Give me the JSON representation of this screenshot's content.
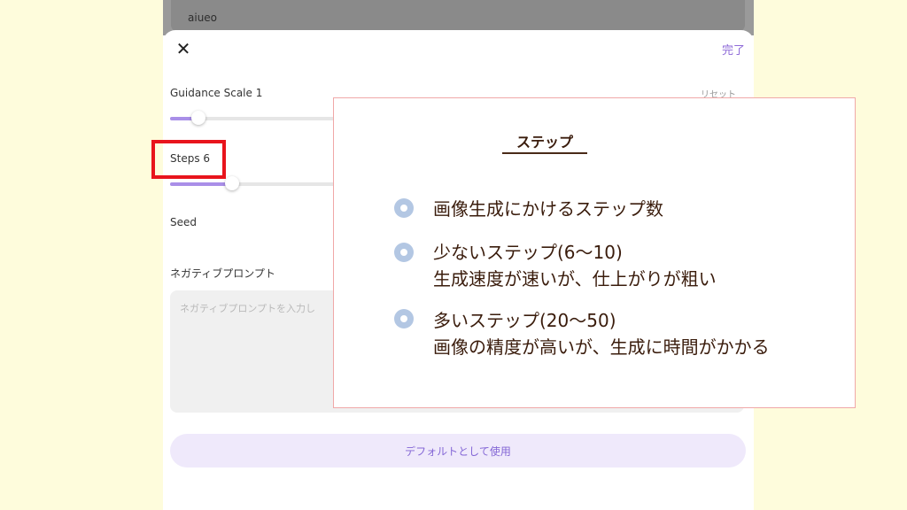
{
  "background": {
    "color": "#fefcdc"
  },
  "previous_field": {
    "value": "aiueo"
  },
  "sheet": {
    "close_icon": "close-icon",
    "done_label": "完了",
    "reset_label": "リセット",
    "guidance": {
      "label": "Guidance Scale 1",
      "value_fraction": 0.05
    },
    "steps": {
      "label": "Steps 6",
      "value_fraction": 0.11
    },
    "seed": {
      "label": "Seed"
    },
    "negative_prompt": {
      "label": "ネガティブプロンプト",
      "placeholder": "ネガティブプロンプトを入力し"
    },
    "default_button": "デフォルトとして使用",
    "accent_color": "#a98fe8"
  },
  "annotation": {
    "highlight_color": "#e8141c"
  },
  "overlay": {
    "title": "ステップ",
    "items": [
      {
        "lines": [
          "画像生成にかけるステップ数"
        ]
      },
      {
        "lines": [
          "少ないステップ(6〜10)",
          "生成速度が速いが、仕上がりが粗い"
        ]
      },
      {
        "lines": [
          "多いステップ(20〜50)",
          "画像の精度が高いが、生成に時間がかかる"
        ]
      }
    ],
    "bullet_color": "#b3c7e3"
  }
}
